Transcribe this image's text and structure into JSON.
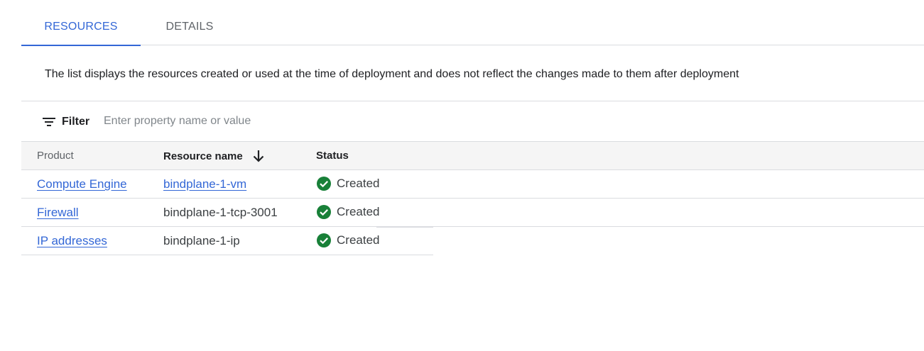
{
  "tabs": [
    {
      "label": "RESOURCES",
      "active": true
    },
    {
      "label": "DETAILS",
      "active": false
    }
  ],
  "notice": "The list displays the resources created or used at the time of deployment and does not reflect the changes made to them after deployment",
  "filter": {
    "label": "Filter",
    "icon": "filter-list-icon",
    "placeholder": "Enter property name or value",
    "value": ""
  },
  "table": {
    "columns": {
      "product": "Product",
      "resource": "Resource name",
      "status": "Status"
    },
    "sort": {
      "column": "resource",
      "direction": "descending",
      "icon": "arrow-down-icon"
    },
    "rows": [
      {
        "product": "Compute Engine",
        "resource": "bindplane-1-vm",
        "resource_is_link": true,
        "status": "Created"
      },
      {
        "product": "Firewall",
        "resource": "bindplane-1-tcp-3001",
        "resource_is_link": false,
        "status": "Created"
      },
      {
        "product": "IP addresses",
        "resource": "bindplane-1-ip",
        "resource_is_link": false,
        "status": "Created"
      }
    ]
  },
  "colors": {
    "accent": "#3367d6",
    "success": "#188038"
  }
}
